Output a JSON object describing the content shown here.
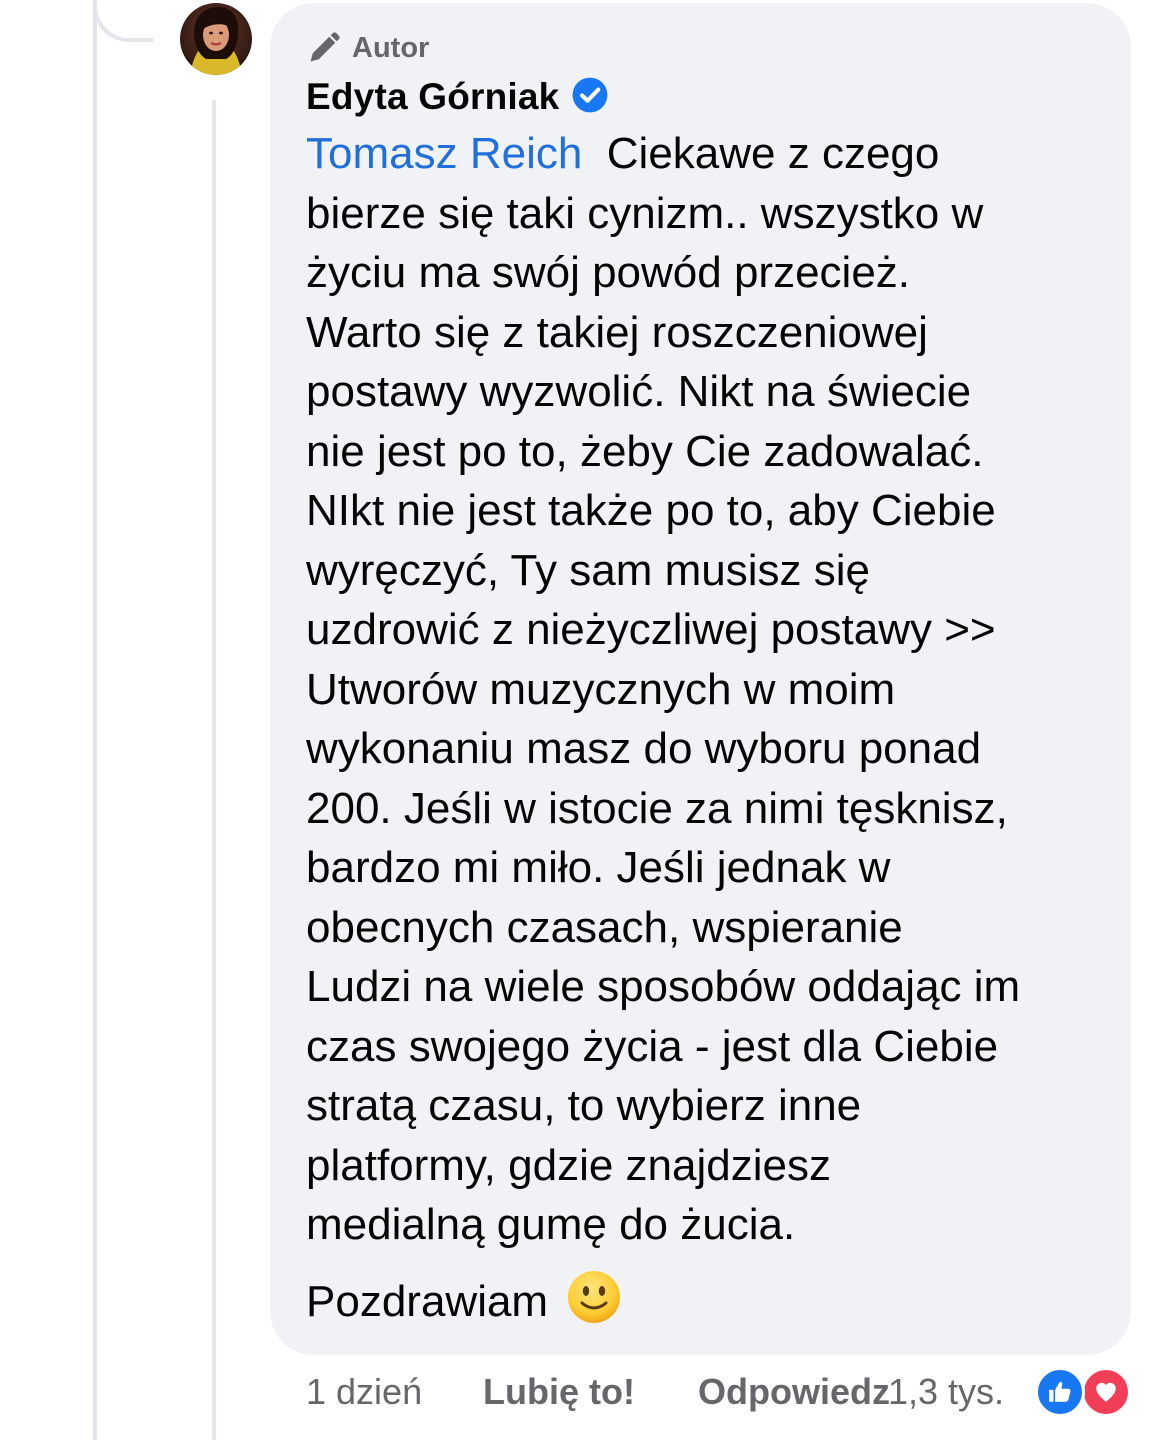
{
  "comment": {
    "author_badge": "Autor",
    "author_name": "Edyta Górniak",
    "verified": true,
    "mention": "Tomasz Reich",
    "body": "Ciekawe z czego\nbierze się taki cynizm.. wszystko w\nżyciu ma swój powód przecież.\nWarto się z takiej roszczeniowej\npostawy wyzwolić. Nikt na świecie\nnie jest po to, żeby Cie zadowalać.\nNIkt nie jest także po to, aby Ciebie\nwyręczyć, Ty sam musisz się\nuzdrowić z nieżyczliwej postawy >>\nUtworów muzycznych w moim\nwykonaniu masz do wyboru ponad\n200. Jeśli w istocie za nimi tęsknisz,\nbardzo mi miło. Jeśli jednak w\nobecnych czasach, wspieranie\nLudzi na wiele sposobów oddając im\nczas swojego życia - jest dla Ciebie\nstratą czasu, to wybierz inne\nplatformy, gdzie znajdziesz\nmedialną gumę do żucia.",
    "greeting": "Pozdrawiam",
    "greeting_emoji": "slightly-smiling-face"
  },
  "meta": {
    "time": "1 dzień",
    "like_label": "Lubię to!",
    "reply_label": "Odpowiedz",
    "reaction_count": "1,3 tys."
  },
  "reactions": [
    "like",
    "love"
  ],
  "colors": {
    "mention": "#216fdb",
    "bubble": "#f0f2f5",
    "verified": "#1877f2",
    "like": "#1877f2",
    "love": "#f33e58",
    "meta_text": "#65676b"
  },
  "icons": {
    "author_badge": "pencil-icon",
    "verified": "verified-badge-icon",
    "like": "thumbs-up-icon",
    "love": "heart-icon"
  }
}
